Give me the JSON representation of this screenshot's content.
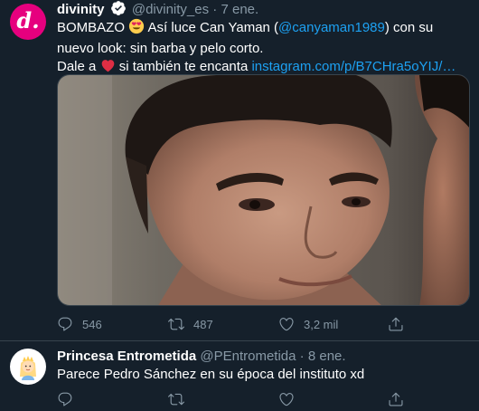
{
  "tweets": [
    {
      "name": "divinity",
      "handle": "@divinity_es",
      "separator": "·",
      "date": "7 ene.",
      "avatar_letter": "d.",
      "text_parts": {
        "p1": "BOMBAZO ",
        "p2": " Así luce Can Yaman (",
        "mention": "@canyaman1989",
        "p3": ") con su nuevo look: sin barba y pelo corto.",
        "p4": "Dale a ",
        "p5": " si también te encanta ",
        "link": "instagram.com/p/B7CHra5oYIJ/…"
      },
      "stats": {
        "replies": "546",
        "retweets": "487",
        "likes": "3,2 mil"
      }
    },
    {
      "name": "Princesa Entrometida",
      "handle": "@PEntrometida",
      "separator": "·",
      "date": "8 ene.",
      "text": "Parece Pedro Sánchez en su época del instituto xd"
    }
  ],
  "colors": {
    "background": "#15202b",
    "secondary_text": "#8899a6",
    "link": "#1da1f2",
    "brand": "#e6007e"
  },
  "icons": [
    "verified-icon",
    "heart-eyes-emoji",
    "red-heart-emoji",
    "reply-icon",
    "retweet-icon",
    "like-icon",
    "share-icon"
  ]
}
